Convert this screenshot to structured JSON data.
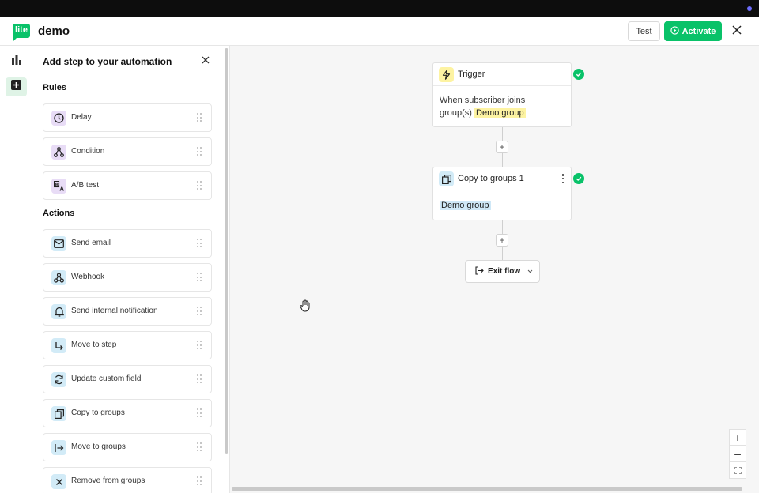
{
  "header": {
    "logo_text": "lite",
    "title": "demo",
    "test_label": "Test",
    "activate_label": "Activate",
    "brand_color": "#09c269"
  },
  "rail": {
    "items": [
      {
        "icon": "bar-chart-icon",
        "active": false
      },
      {
        "icon": "plus-square-icon",
        "active": true
      }
    ]
  },
  "panel": {
    "title": "Add step to your automation",
    "rules_heading": "Rules",
    "rules": [
      {
        "label": "Delay",
        "icon": "clock-icon"
      },
      {
        "label": "Condition",
        "icon": "condition-branch-icon"
      },
      {
        "label": "A/B test",
        "icon": "ab-test-icon"
      }
    ],
    "actions_heading": "Actions",
    "actions": [
      {
        "label": "Send email",
        "icon": "envelope-icon"
      },
      {
        "label": "Webhook",
        "icon": "webhook-icon"
      },
      {
        "label": "Send internal notification",
        "icon": "bell-icon"
      },
      {
        "label": "Move to step",
        "icon": "move-arrow-icon"
      },
      {
        "label": "Update custom field",
        "icon": "refresh-icon"
      },
      {
        "label": "Copy to groups",
        "icon": "copy-icon"
      },
      {
        "label": "Move to groups",
        "icon": "move-to-group-icon"
      },
      {
        "label": "Remove from groups",
        "icon": "x-icon"
      }
    ]
  },
  "canvas": {
    "trigger": {
      "title": "Trigger",
      "body_prefix_line1": "When subscriber joins",
      "body_prefix_line2": "group(s)",
      "group": "Demo group"
    },
    "copy_step": {
      "title": "Copy to groups 1",
      "group": "Demo group"
    },
    "exit_label": "Exit flow",
    "add_label": "+"
  },
  "zoom": {
    "in_label": "+",
    "out_label": "–"
  }
}
